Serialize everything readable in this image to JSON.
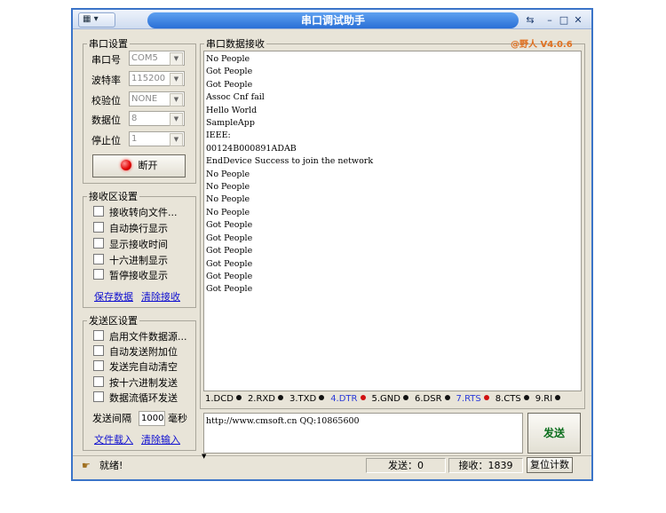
{
  "window": {
    "title": "串口调试助手"
  },
  "version": "@野人 V4.0.6",
  "serial": {
    "group_label": "串口设置",
    "port_label": "串口号",
    "port_value": "COM5",
    "baud_label": "波特率",
    "baud_value": "115200",
    "parity_label": "校验位",
    "parity_value": "NONE",
    "databits_label": "数据位",
    "databits_value": "8",
    "stopbits_label": "停止位",
    "stopbits_value": "1",
    "connect_label": "断开"
  },
  "receive_settings": {
    "group_label": "接收区设置",
    "options": [
      "接收转向文件...",
      "自动换行显示",
      "显示接收时间",
      "十六进制显示",
      "暂停接收显示"
    ],
    "save_link": "保存数据",
    "clear_link": "清除接收"
  },
  "send_settings": {
    "group_label": "发送区设置",
    "options": [
      "启用文件数据源...",
      "自动发送附加位",
      "发送完自动清空",
      "按十六进制发送",
      "数据流循环发送"
    ],
    "interval_label": "发送间隔",
    "interval_value": "1000",
    "interval_unit": "毫秒",
    "load_link": "文件载入",
    "clear_link": "清除输入"
  },
  "receive_area": {
    "group_label": "串口数据接收",
    "text": "No People\nGot People\nGot People\nAssoc Cnf fail\nHello World\nSampleApp\nIEEE:\n00124B000891ADAB\nEndDevice Success to join the network\nNo People\nNo People\nNo People\nNo People\nGot People\nGot People\nGot People\nGot People\nGot People\nGot People"
  },
  "signals": [
    {
      "label": "1.DCD",
      "color": "#111111",
      "active": false
    },
    {
      "label": "2.RXD",
      "color": "#111111",
      "active": false
    },
    {
      "label": "3.TXD",
      "color": "#111111",
      "active": false
    },
    {
      "label": "4.DTR",
      "color": "#d01010",
      "active": true
    },
    {
      "label": "5.GND",
      "color": "#111111",
      "active": false
    },
    {
      "label": "6.DSR",
      "color": "#111111",
      "active": false
    },
    {
      "label": "7.RTS",
      "color": "#d01010",
      "active": true
    },
    {
      "label": "8.CTS",
      "color": "#111111",
      "active": false
    },
    {
      "label": "9.RI",
      "color": "#111111",
      "active": false
    }
  ],
  "send_area": {
    "text": "http://www.cmsoft.cn QQ:10865600",
    "send_label": "发送"
  },
  "status_bar": {
    "status_text": "就绪!",
    "sent": "发送：0",
    "received": "接收：1839",
    "reset_label": "复位计数"
  },
  "colors": {
    "accent": "#3b74c8",
    "active_signal": "#d01010",
    "link": "#1010d0",
    "version": "#e07020"
  }
}
